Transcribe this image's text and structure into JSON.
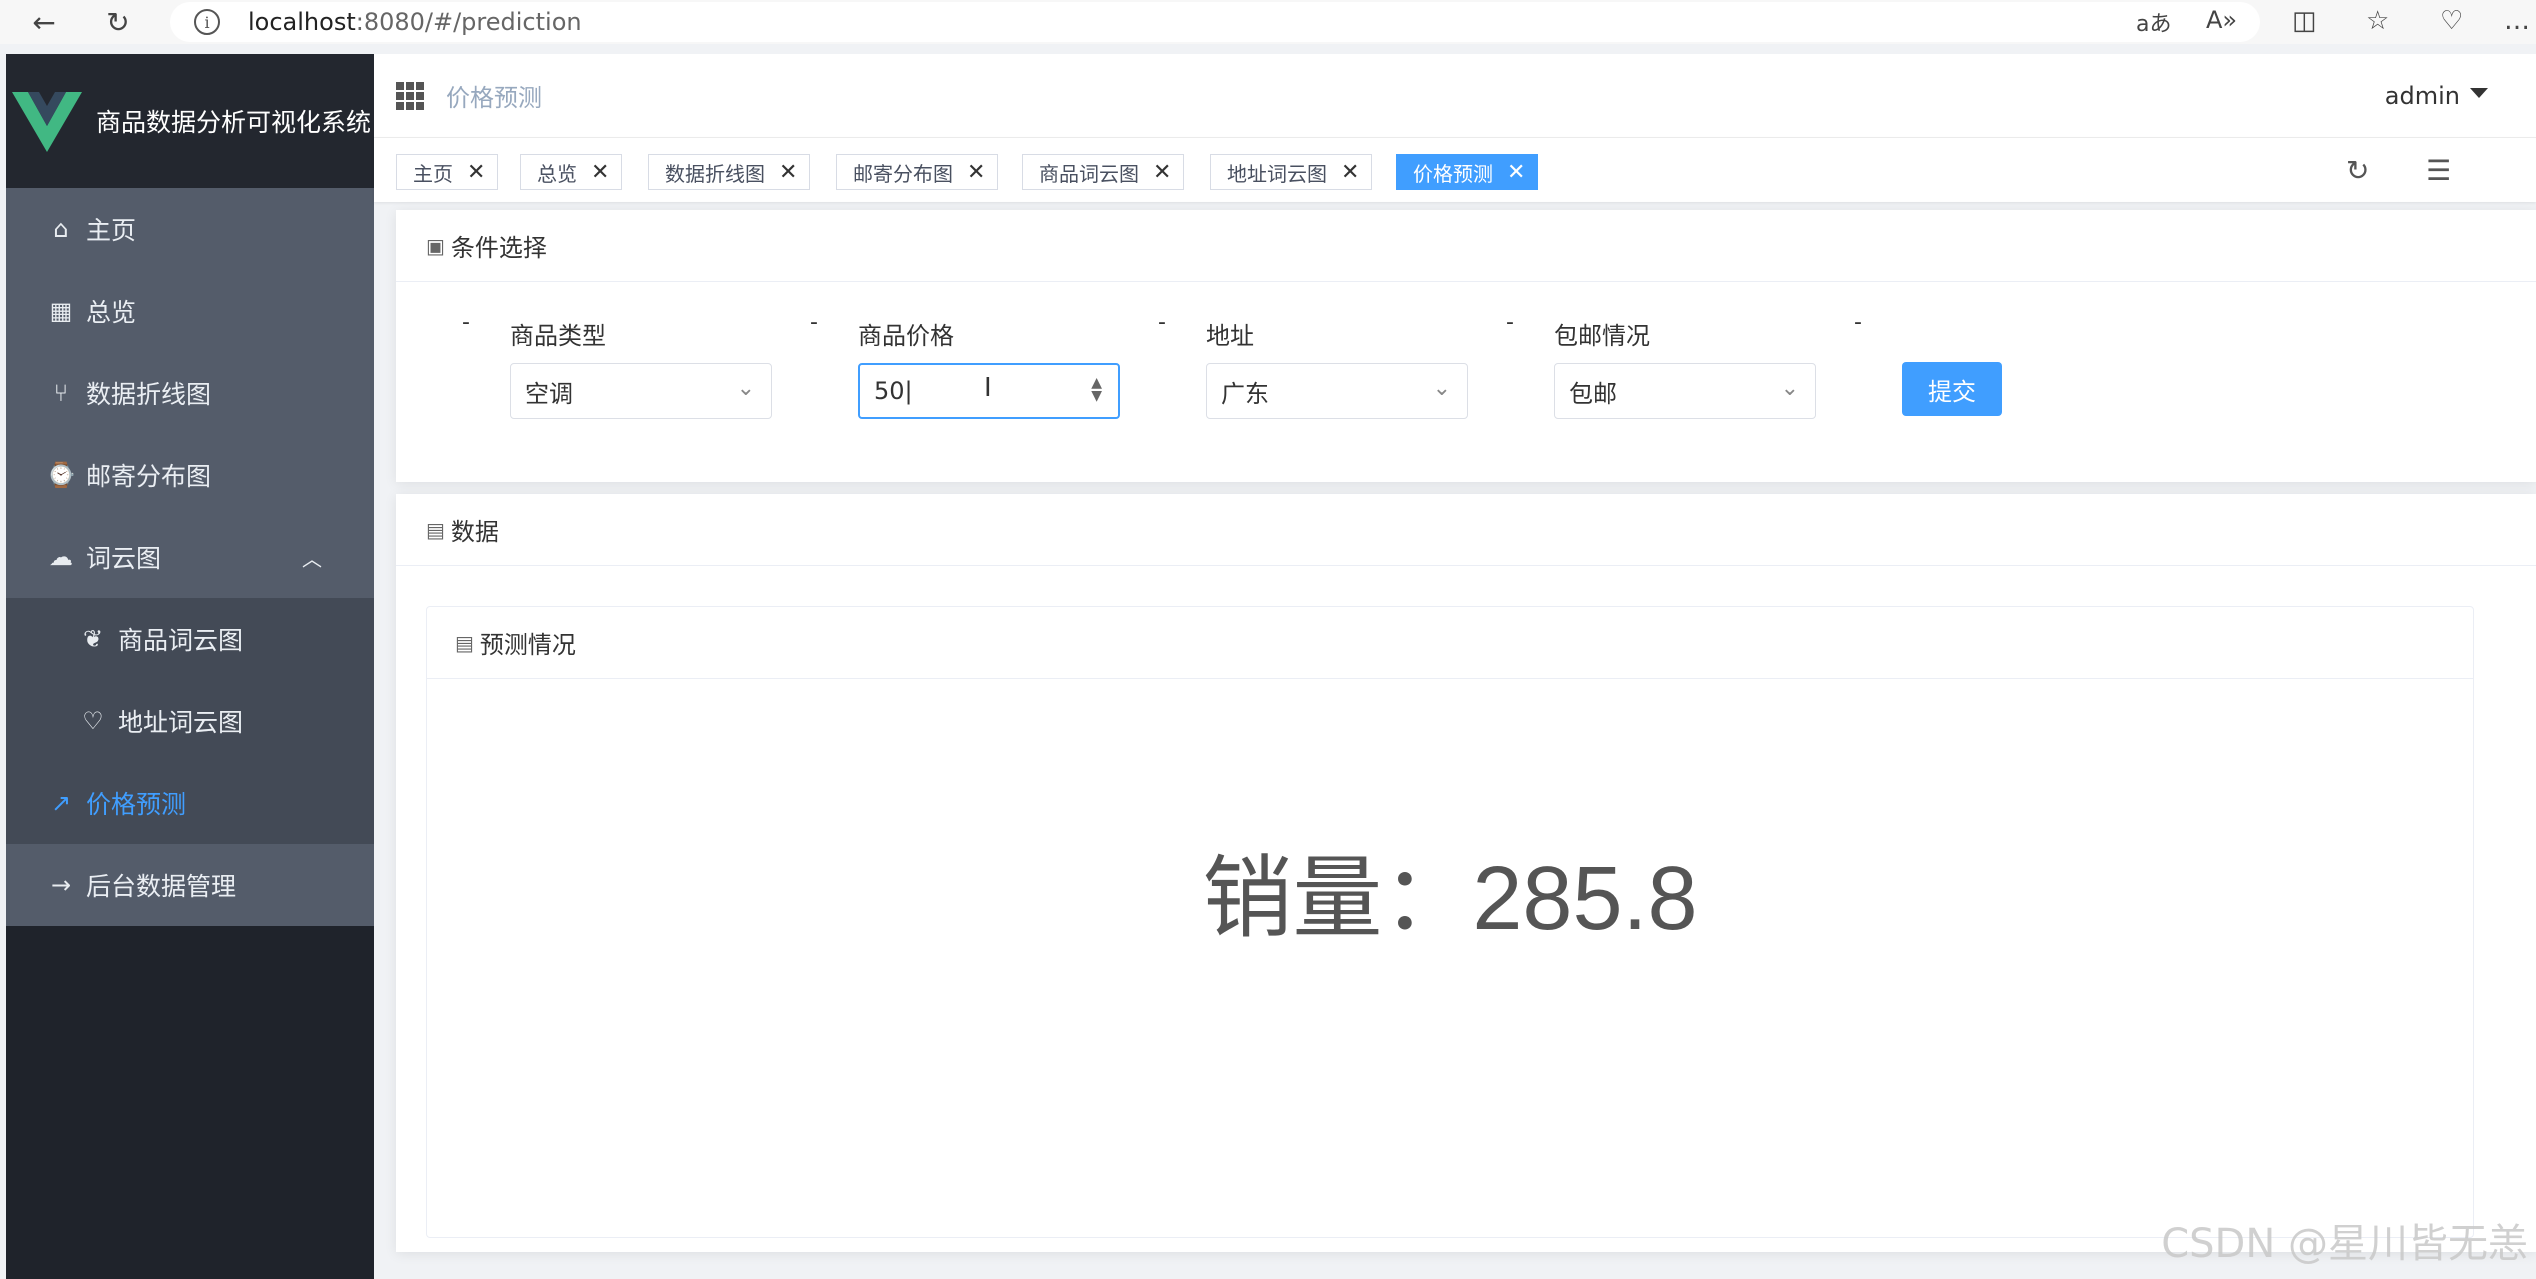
{
  "browser": {
    "url_host": "localhost",
    "url_rest": ":8080/#/prediction"
  },
  "sidebar": {
    "app_title": "商品数据分析可视化系统",
    "items": [
      {
        "label": "主页",
        "icon": "home-icon"
      },
      {
        "label": "总览",
        "icon": "grid-icon"
      },
      {
        "label": "数据折线图",
        "icon": "branch-icon"
      },
      {
        "label": "邮寄分布图",
        "icon": "watch-icon"
      },
      {
        "label": "词云图",
        "icon": "cloud-icon",
        "expanded": true
      },
      {
        "label": "商品词云图",
        "icon": "leaf-icon"
      },
      {
        "label": "地址词云图",
        "icon": "heart-icon"
      },
      {
        "label": "价格预测",
        "icon": "trend-icon",
        "active": true
      },
      {
        "label": "后台数据管理",
        "icon": "arrow-right-icon"
      }
    ]
  },
  "header": {
    "breadcrumb": "价格预测",
    "user": "admin"
  },
  "tags": [
    {
      "label": "主页"
    },
    {
      "label": "总览"
    },
    {
      "label": "数据折线图"
    },
    {
      "label": "邮寄分布图"
    },
    {
      "label": "商品词云图"
    },
    {
      "label": "地址词云图"
    },
    {
      "label": "价格预测",
      "active": true
    }
  ],
  "conditions": {
    "title": "条件选择",
    "product_type": {
      "label": "商品类型",
      "value": "空调"
    },
    "price": {
      "label": "商品价格",
      "value": "50"
    },
    "address": {
      "label": "地址",
      "value": "广东"
    },
    "shipping": {
      "label": "包邮情况",
      "value": "包邮"
    },
    "submit_label": "提交",
    "separator": "-"
  },
  "data_panel": {
    "title": "数据",
    "inner_title": "预测情况",
    "result_text": "销量：285.8"
  },
  "watermark": "CSDN @星川皆无恙",
  "colors": {
    "accent": "#409eff",
    "sidebar_bg": "#1f232b",
    "menu_bg": "#545c6a",
    "submenu_bg": "#434a56"
  }
}
